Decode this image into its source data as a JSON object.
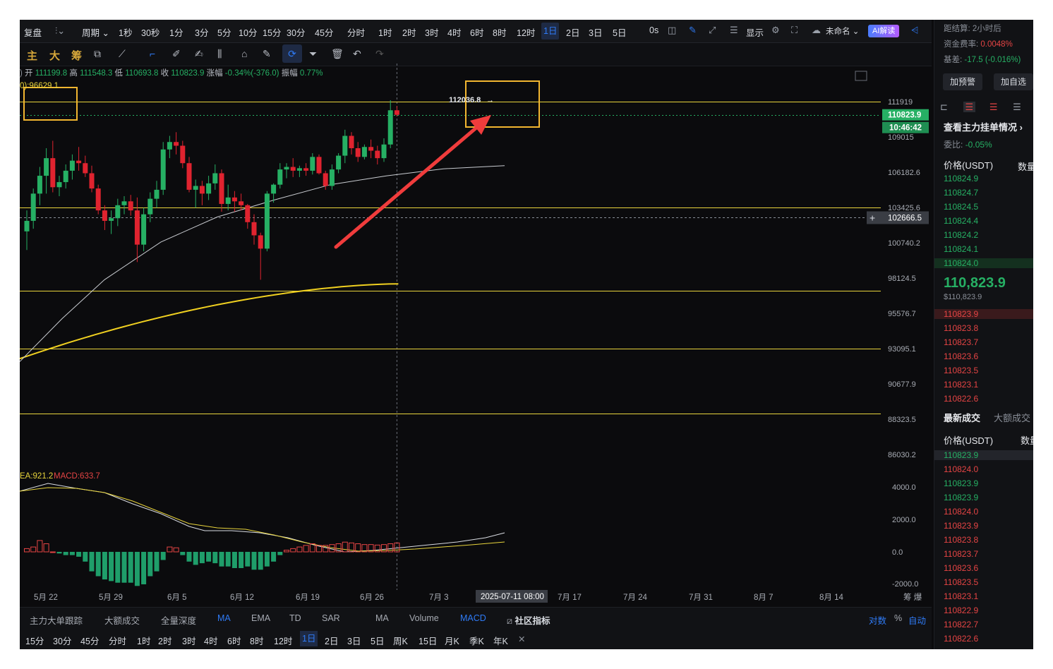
{
  "toolbar": {
    "replay": "复盘",
    "period": "周期",
    "timeframes": [
      "1秒",
      "30秒",
      "1分",
      "3分",
      "5分",
      "10分",
      "15分",
      "30分",
      "45分",
      "分时",
      "1时",
      "2时",
      "3时",
      "4时",
      "6时",
      "8时",
      "12时",
      "1日",
      "2日",
      "3日",
      "5日"
    ],
    "active_timeframe": "1日",
    "latency": "0s",
    "display": "显示",
    "layout_name": "未命名",
    "ai": "AI解读"
  },
  "drawbar": {
    "labels": [
      "主",
      "大",
      "筹"
    ]
  },
  "ohlc": {
    "open_label": "开",
    "open": "111199.8",
    "high_label": "高",
    "high": "111548.3",
    "low_label": "低",
    "low": "110693.8",
    "close_label": "收",
    "close": "110823.9",
    "change_label": "涨幅",
    "change": "-0.34%(-376.0)",
    "amp_label": "振幅",
    "amp": "0.77%"
  },
  "chart_data": {
    "type": "candlestick",
    "ma_label": "0):96629.1",
    "yticks": [
      111919.0,
      109015.0,
      106182.6,
      103425.6,
      100740.2,
      98124.5,
      95576.7,
      93095.1,
      90677.9,
      88323.5,
      86030.2
    ],
    "price_tag": "110823.9",
    "countdown_tag": "10:46:42",
    "crosshair_price": "102666.5",
    "high_annotation": "112036.8",
    "x_labels": [
      "5月 22",
      "5月 29",
      "6月 5",
      "6月 12",
      "6月 19",
      "6月 26",
      "7月 3",
      "2025-07-11 08:00",
      "7月 17",
      "7月 24",
      "7月 31",
      "8月 7",
      "8月 14"
    ],
    "horizontal_levels": [
      111919.0,
      103425.6,
      97200,
      93095.1,
      88680
    ],
    "candles": [
      [
        101600,
        103200,
        100200,
        102400
      ],
      [
        102400,
        104900,
        101800,
        104500
      ],
      [
        104500,
        106600,
        103600,
        105900
      ],
      [
        105900,
        108100,
        104500,
        107300
      ],
      [
        107300,
        108700,
        104600,
        105000
      ],
      [
        105000,
        105900,
        104300,
        105400
      ],
      [
        105400,
        106800,
        104900,
        106300
      ],
      [
        106300,
        107600,
        105600,
        107100
      ],
      [
        107100,
        108200,
        106300,
        106900
      ],
      [
        106900,
        107500,
        105800,
        106100
      ],
      [
        106100,
        106700,
        104600,
        104900
      ],
      [
        104900,
        105200,
        102900,
        103200
      ],
      [
        103200,
        103600,
        101700,
        102400
      ],
      [
        102400,
        103200,
        101400,
        102600
      ],
      [
        102600,
        104100,
        102000,
        103600
      ],
      [
        103600,
        104300,
        102900,
        103900
      ],
      [
        103900,
        104400,
        102800,
        103200
      ],
      [
        103200,
        104200,
        99300,
        100600
      ],
      [
        100600,
        103400,
        100100,
        102900
      ],
      [
        102900,
        104600,
        102300,
        104100
      ],
      [
        104100,
        105500,
        103400,
        104800
      ],
      [
        104800,
        108600,
        104400,
        108000
      ],
      [
        108000,
        109100,
        107300,
        108600
      ],
      [
        108600,
        109400,
        107600,
        108300
      ],
      [
        108300,
        108700,
        106500,
        106900
      ],
      [
        106900,
        107400,
        104600,
        104800
      ],
      [
        104800,
        105600,
        103400,
        105100
      ],
      [
        105100,
        105500,
        103600,
        104500
      ],
      [
        104500,
        105900,
        104000,
        105300
      ],
      [
        105300,
        106800,
        104800,
        106100
      ],
      [
        106100,
        106400,
        103100,
        103700
      ],
      [
        103700,
        105200,
        103200,
        104200
      ],
      [
        104200,
        104700,
        103100,
        103900
      ],
      [
        103900,
        104500,
        103200,
        103600
      ],
      [
        103600,
        103700,
        101800,
        102300
      ],
      [
        102300,
        102900,
        100600,
        101300
      ],
      [
        101300,
        101500,
        98000,
        100300
      ],
      [
        100300,
        104700,
        100100,
        104500
      ],
      [
        104500,
        105300,
        103800,
        105200
      ],
      [
        105200,
        106900,
        104900,
        106400
      ],
      [
        106400,
        106900,
        105700,
        106600
      ],
      [
        106600,
        107300,
        105800,
        106300
      ],
      [
        106300,
        106700,
        105800,
        106500
      ],
      [
        106500,
        106900,
        105900,
        106300
      ],
      [
        106300,
        107700,
        106000,
        107400
      ],
      [
        107400,
        107600,
        106000,
        106100
      ],
      [
        106100,
        106300,
        104800,
        105100
      ],
      [
        105100,
        106800,
        104800,
        106400
      ],
      [
        106400,
        107700,
        106100,
        107500
      ],
      [
        107500,
        109600,
        106900,
        109100
      ],
      [
        109100,
        109400,
        107600,
        108100
      ],
      [
        108100,
        108600,
        107000,
        107400
      ],
      [
        107400,
        108400,
        107200,
        108200
      ],
      [
        108200,
        108800,
        107300,
        107900
      ],
      [
        107900,
        108300,
        106800,
        107300
      ],
      [
        107300,
        108900,
        107000,
        108400
      ],
      [
        108400,
        112036.8,
        108100,
        111199.8
      ],
      [
        111199.8,
        111548.3,
        110693.8,
        110823.9
      ]
    ],
    "ma_short": [
      103300,
      103500,
      103900,
      104250,
      104600,
      104750,
      105000,
      105250,
      105450,
      105600,
      105750,
      105800,
      105850,
      105900,
      105950,
      106000,
      106050,
      106000,
      106050,
      106200,
      106300,
      106500,
      106600,
      106700
    ],
    "ma_long_start": 92400,
    "ma_long_end": 97700,
    "macd_labels": {
      "dea": "EA:921.2",
      "macd": "MACD:633.7"
    },
    "macd_yticks": [
      "4000.0",
      "2000.0",
      "0.0",
      "-2000.0"
    ],
    "macd_hist": [
      200,
      300,
      700,
      500,
      0,
      -100,
      -200,
      -200,
      -300,
      -600,
      -1200,
      -1500,
      -1700,
      -1800,
      -1900,
      -1900,
      -1900,
      -2100,
      -2000,
      -1500,
      -1200,
      -500,
      300,
      250,
      -200,
      -600,
      -800,
      -700,
      -600,
      -700,
      -900,
      -900,
      -1000,
      -1000,
      -900,
      -1100,
      -1100,
      -900,
      -600,
      -200,
      100,
      200,
      300,
      400,
      500,
      400,
      400,
      450,
      500,
      600,
      550,
      500,
      450,
      450,
      420,
      450,
      500,
      550
    ]
  },
  "indicators": {
    "main_items": [
      "主力大单跟踪",
      "大额成交",
      "全量深度",
      "MA",
      "EMA",
      "TD",
      "SAR"
    ],
    "sub_items": [
      "MA",
      "Volume",
      "MACD"
    ],
    "community": "社区指标",
    "log": "对数",
    "percent": "%",
    "auto": "自动",
    "active": [
      "MA",
      "MACD"
    ]
  },
  "bottom_timeframes": [
    "15分",
    "30分",
    "45分",
    "分时",
    "1时",
    "2时",
    "3时",
    "4时",
    "6时",
    "8时",
    "12时",
    "1日",
    "2日",
    "3日",
    "5日",
    "周K",
    "15日",
    "月K",
    "季K",
    "年K"
  ],
  "bottom_active": "1日",
  "right_panel": {
    "settle_label": "距结算:",
    "settle_value": "2小时后",
    "funding_label": "资金费率:",
    "funding_value": "0.0048%",
    "basis_label": "基差:",
    "basis_value": "-17.5 (-0.016%)",
    "alert_btn": "加预警",
    "watch_btn": "加自选",
    "orders_title": "查看主力挂单情况",
    "ratio_label": "委比:",
    "ratio_value": "-0.05%",
    "price_header": "价格(USDT)",
    "qty_header": "数量",
    "bids": [
      "110824.9",
      "110824.7",
      "110824.5",
      "110824.4",
      "110824.2",
      "110824.1",
      "110824.0"
    ],
    "last_price": "110,823.9",
    "last_price_usd": "$110,823.9",
    "asks": [
      "110823.9",
      "110823.8",
      "110823.7",
      "110823.6",
      "110823.5",
      "110823.1",
      "110822.6"
    ],
    "trades_tab": "最新成交",
    "big_trades_tab": "大额成交",
    "trades": [
      {
        "p": "110823.9",
        "c": "green"
      },
      {
        "p": "110824.0",
        "c": "red"
      },
      {
        "p": "110823.9",
        "c": "green"
      },
      {
        "p": "110823.9",
        "c": "green"
      },
      {
        "p": "110824.0",
        "c": "red"
      },
      {
        "p": "110823.9",
        "c": "red"
      },
      {
        "p": "110823.8",
        "c": "red"
      },
      {
        "p": "110823.7",
        "c": "red"
      },
      {
        "p": "110823.6",
        "c": "red"
      },
      {
        "p": "110823.5",
        "c": "red"
      },
      {
        "p": "110823.1",
        "c": "red"
      },
      {
        "p": "110822.9",
        "c": "red"
      },
      {
        "p": "110822.7",
        "c": "red"
      },
      {
        "p": "110822.6",
        "c": "red"
      }
    ]
  },
  "colors": {
    "up": "#26b064",
    "down": "#e0232f",
    "level": "#e8d43c",
    "arrow": "#f03c3c",
    "box": "#f2b630",
    "accent": "#2f7bf6"
  }
}
